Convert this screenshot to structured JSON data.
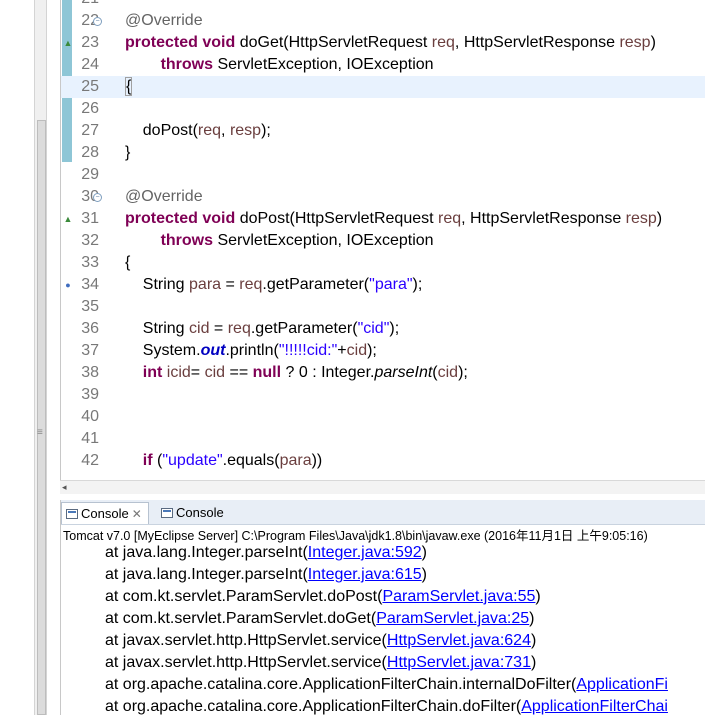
{
  "editor": {
    "lines": [
      {
        "num": "21",
        "segments": []
      },
      {
        "num": "22",
        "fold": true,
        "segments": [
          {
            "t": "@Override",
            "c": "ann"
          }
        ]
      },
      {
        "num": "23",
        "marker": "override",
        "segments": [
          {
            "t": "protected",
            "c": "kw"
          },
          {
            "t": " "
          },
          {
            "t": "void",
            "c": "kw"
          },
          {
            "t": " doGet(HttpServletRequest "
          },
          {
            "t": "req",
            "c": "var"
          },
          {
            "t": ", HttpServletResponse "
          },
          {
            "t": "resp",
            "c": "var"
          },
          {
            "t": ")"
          }
        ]
      },
      {
        "num": "24",
        "segments": [
          {
            "t": "        "
          },
          {
            "t": "throws",
            "c": "kw"
          },
          {
            "t": " ServletException, IOException"
          }
        ]
      },
      {
        "num": "25",
        "current": true,
        "segments": [
          {
            "t": "{",
            "c": "brace"
          }
        ]
      },
      {
        "num": "26",
        "segments": []
      },
      {
        "num": "27",
        "segments": [
          {
            "t": "    doPost("
          },
          {
            "t": "req",
            "c": "var"
          },
          {
            "t": ", "
          },
          {
            "t": "resp",
            "c": "var"
          },
          {
            "t": ");"
          }
        ]
      },
      {
        "num": "28",
        "segments": [
          {
            "t": "}"
          }
        ]
      },
      {
        "num": "29",
        "segments": []
      },
      {
        "num": "30",
        "fold": true,
        "segments": [
          {
            "t": "@Override",
            "c": "ann"
          }
        ]
      },
      {
        "num": "31",
        "marker": "override",
        "segments": [
          {
            "t": "protected",
            "c": "kw"
          },
          {
            "t": " "
          },
          {
            "t": "void",
            "c": "kw"
          },
          {
            "t": " doPost(HttpServletRequest "
          },
          {
            "t": "req",
            "c": "var"
          },
          {
            "t": ", HttpServletResponse "
          },
          {
            "t": "resp",
            "c": "var"
          },
          {
            "t": ")"
          }
        ]
      },
      {
        "num": "32",
        "segments": [
          {
            "t": "        "
          },
          {
            "t": "throws",
            "c": "kw"
          },
          {
            "t": " ServletException, IOException"
          }
        ]
      },
      {
        "num": "33",
        "segments": [
          {
            "t": "{"
          }
        ]
      },
      {
        "num": "34",
        "marker": "bp",
        "segments": [
          {
            "t": "    String "
          },
          {
            "t": "para",
            "c": "var"
          },
          {
            "t": " = "
          },
          {
            "t": "req",
            "c": "var"
          },
          {
            "t": ".getParameter("
          },
          {
            "t": "\"para\"",
            "c": "str"
          },
          {
            "t": ");"
          }
        ]
      },
      {
        "num": "35",
        "segments": []
      },
      {
        "num": "36",
        "segments": [
          {
            "t": "    String "
          },
          {
            "t": "cid",
            "c": "var"
          },
          {
            "t": " = "
          },
          {
            "t": "req",
            "c": "var"
          },
          {
            "t": ".getParameter("
          },
          {
            "t": "\"cid\"",
            "c": "str"
          },
          {
            "t": ");"
          }
        ]
      },
      {
        "num": "37",
        "segments": [
          {
            "t": "    System."
          },
          {
            "t": "out",
            "c": "fld"
          },
          {
            "t": ".println("
          },
          {
            "t": "\"!!!!!cid:\"",
            "c": "str"
          },
          {
            "t": "+"
          },
          {
            "t": "cid",
            "c": "var"
          },
          {
            "t": ");"
          }
        ]
      },
      {
        "num": "38",
        "segments": [
          {
            "t": "    "
          },
          {
            "t": "int",
            "c": "kw"
          },
          {
            "t": " "
          },
          {
            "t": "icid",
            "c": "var"
          },
          {
            "t": "= "
          },
          {
            "t": "cid",
            "c": "var"
          },
          {
            "t": " == "
          },
          {
            "t": "null",
            "c": "kw"
          },
          {
            "t": " ? 0 : Integer."
          },
          {
            "t": "parseInt",
            "c": "stat"
          },
          {
            "t": "("
          },
          {
            "t": "cid",
            "c": "var"
          },
          {
            "t": ");"
          }
        ]
      },
      {
        "num": "39",
        "segments": []
      },
      {
        "num": "40",
        "segments": []
      },
      {
        "num": "41",
        "segments": []
      },
      {
        "num": "42",
        "segments": [
          {
            "t": "    "
          },
          {
            "t": "if",
            "c": "kw"
          },
          {
            "t": " ("
          },
          {
            "t": "\"update\"",
            "c": "str"
          },
          {
            "t": ".equals("
          },
          {
            "t": "para",
            "c": "var"
          },
          {
            "t": "))"
          }
        ]
      }
    ]
  },
  "console": {
    "tabs": [
      {
        "label": "Console",
        "close": "✕",
        "active": true
      },
      {
        "label": "Console",
        "active": false
      }
    ],
    "header": "Tomcat v7.0 [MyEclipse Server] C:\\Program Files\\Java\\jdk1.8\\bin\\javaw.exe (2016年11月1日 上午9:05:16)",
    "trace": [
      {
        "prefix": "at java.lang.Integer.parseInt(",
        "link": "Integer.java:592",
        "suffix": ")"
      },
      {
        "prefix": "at java.lang.Integer.parseInt(",
        "link": "Integer.java:615",
        "suffix": ")"
      },
      {
        "prefix": "at com.kt.servlet.ParamServlet.doPost(",
        "link": "ParamServlet.java:55",
        "suffix": ")"
      },
      {
        "prefix": "at com.kt.servlet.ParamServlet.doGet(",
        "link": "ParamServlet.java:25",
        "suffix": ")"
      },
      {
        "prefix": "at javax.servlet.http.HttpServlet.service(",
        "link": "HttpServlet.java:624",
        "suffix": ")"
      },
      {
        "prefix": "at javax.servlet.http.HttpServlet.service(",
        "link": "HttpServlet.java:731",
        "suffix": ")"
      },
      {
        "prefix": "at org.apache.catalina.core.ApplicationFilterChain.internalDoFilter(",
        "link": "ApplicationFi",
        "suffix": ""
      },
      {
        "prefix": "at org.apache.catalina.core.ApplicationFilterChain.doFilter(",
        "link": "ApplicationFilterChai",
        "suffix": ""
      }
    ]
  }
}
